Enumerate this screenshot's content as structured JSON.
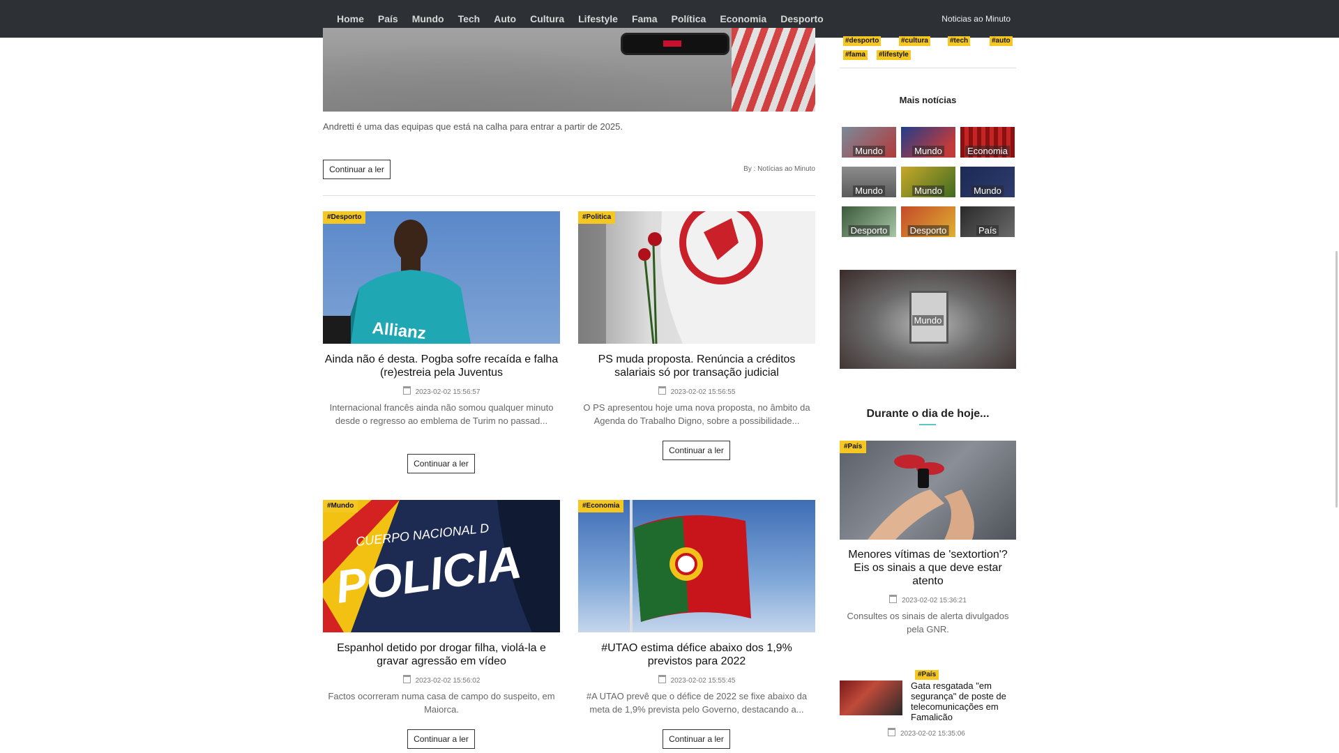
{
  "nav": {
    "items": [
      "Home",
      "País",
      "Mundo",
      "Tech",
      "Auto",
      "Cultura",
      "Lifestyle",
      "Fama",
      "Política",
      "Economia",
      "Desporto"
    ],
    "brand": "Noticias ao Minuto"
  },
  "hero": {
    "caption": "Andretti é uma das equipas que está na calha para entrar a partir de 2025.",
    "read_more": "Continuar a ler",
    "byline": "By : Notícias ao Minuto"
  },
  "articles": [
    {
      "tag": "#Desporto",
      "title": "Ainda não é desta. Pogba sofre recaída e falha (re)estreia pela Juventus",
      "date": "2023-02-02 15:56:57",
      "excerpt": "Internacional francês ainda não somou qualquer minuto desde o regresso ao emblema de Turim no passad...",
      "read_more": "Continuar a ler"
    },
    {
      "tag": "#Politica",
      "title": "PS muda proposta. Renúncia a créditos salariais só por transação judicial",
      "date": "2023-02-02 15:56:55",
      "excerpt": "O PS apresentou hoje uma nova proposta, no âmbito da Agenda do Trabalho Digno, sobre a possibilidade...",
      "read_more": "Continuar a ler"
    },
    {
      "tag": "#Mundo",
      "title": "Espanhol detido por drogar filha, violá-la e gravar agressão em vídeo",
      "date": "2023-02-02 15:56:02",
      "excerpt": "Factos ocorreram numa casa de campo do suspeito, em Maiorca.",
      "read_more": "Continuar a ler"
    },
    {
      "tag": "#Economia",
      "title": "#UTAO estima défice abaixo dos 1,9% previstos para 2022",
      "date": "2023-02-02 15:55:45",
      "excerpt": "#A UTAO prevê que o défice de 2022 se fixe abaixo da meta de 1,9% prevista pelo Governo, destacando a...",
      "read_more": "Continuar a ler"
    }
  ],
  "police_image_text": {
    "line1": "CUERPO NACIONAL D",
    "line2": "POLICIA"
  },
  "sidebar": {
    "tags": [
      "#desporto",
      "#cultura",
      "#tech",
      "#auto",
      "#fama",
      "#lifestyle"
    ],
    "more_news_heading": "Mais notícias",
    "thumbs": [
      "Mundo",
      "Mundo",
      "Economia",
      "Mundo",
      "Mundo",
      "Mundo",
      "Desporto",
      "Desporto",
      "País"
    ],
    "big_label": "Mundo",
    "today_heading": "Durante o dia de hoje...",
    "featured": {
      "tag": "#País",
      "title": "Menores vítimas de 'sextortion'? Eis os sinais a que deve estar atento",
      "date": "2023-02-02 15:36:21",
      "excerpt": "Consultes os sinais de alerta divulgados pela GNR."
    },
    "mini": {
      "tag": "#País",
      "title": "Gata resgatada \"em segurança\" de poste de telecomunicações em Famalicão",
      "date": "2023-02-02 15:35:06"
    }
  }
}
